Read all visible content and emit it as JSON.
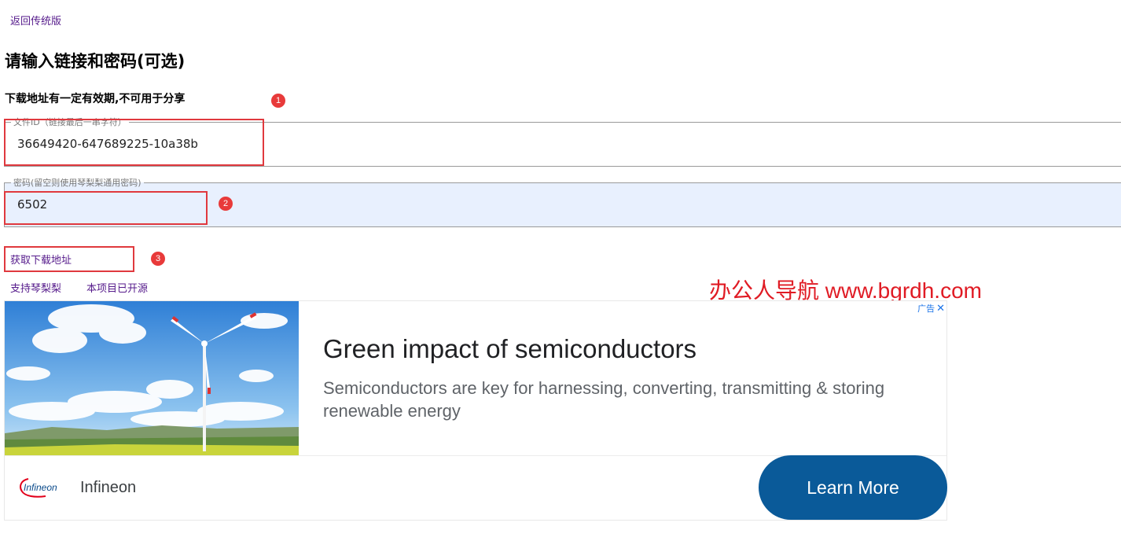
{
  "nav": {
    "back_label": "返回传统版"
  },
  "form": {
    "title": "请输入链接和密码(可选)",
    "notice": "下载地址有一定有效期,不可用于分享",
    "file_id": {
      "legend": "文件ID（链接最后一串字符）",
      "value": "36649420-647689225-10a38b"
    },
    "password": {
      "legend": "密码(留空则使用琴梨梨通用密码)",
      "value": "6502"
    },
    "submit_label": "获取下载地址"
  },
  "links": {
    "support_label": "支持琴梨梨",
    "opensource_label": "本项目已开源"
  },
  "annotations": [
    "1",
    "2",
    "3"
  ],
  "watermark": "办公人导航 www.bgrdh.com",
  "ad": {
    "label": "广告",
    "title": "Green impact of semiconductors",
    "description": "Semiconductors are key for harnessing, converting, transmitting & storing renewable energy",
    "logo_text": "Infineon",
    "brand": "Infineon",
    "cta_label": "Learn More",
    "cta_color": "#0a5a99"
  },
  "colors": {
    "link": "#551a8b",
    "annotation": "#e0393e",
    "autofill_bg": "#e8f0fe"
  }
}
